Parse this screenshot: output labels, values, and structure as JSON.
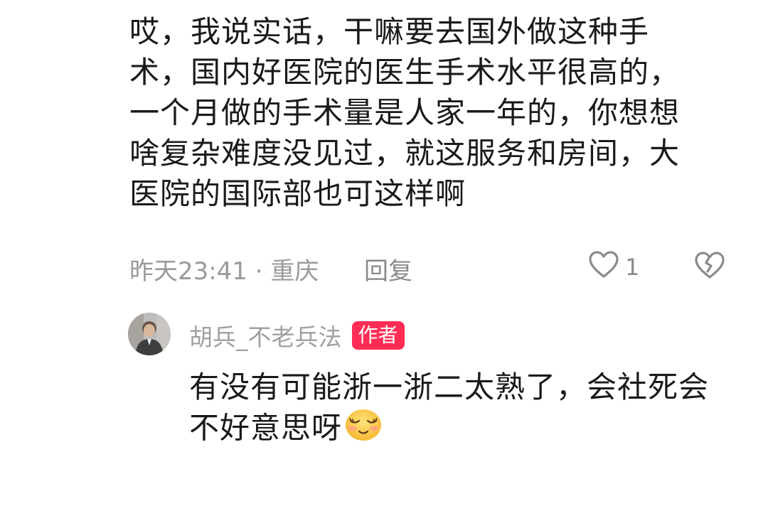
{
  "comment": {
    "lines": [
      "哎，我说实话，干嘛要去国外做这种手",
      "术，国内好医院的医生手术水平很高的，",
      "一个月做的手术量是人家一年的，你想想",
      "啥复杂难度没见过，就这服务和房间，大",
      "医院的国际部也可这样啊"
    ],
    "timestamp": "昨天23:41 · 重庆",
    "reply_label": "回复",
    "like_count": "1"
  },
  "reply": {
    "author_name": "胡兵_不老兵法",
    "author_badge": "作者",
    "lines": [
      "有没有可能浙一浙二太熟了，会社死会",
      "不好意思呀"
    ],
    "emoji_icon": "shy-smile-emoji"
  },
  "colors": {
    "text": "#1a1a1a",
    "meta": "#9a9a9a",
    "badge": "#ff2d55"
  }
}
